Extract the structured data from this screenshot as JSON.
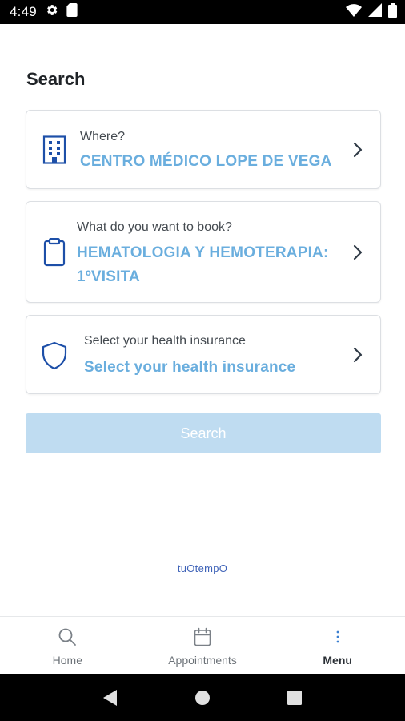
{
  "status_bar": {
    "time": "4:49",
    "icons": [
      "gear-icon",
      "sd-card-icon",
      "wifi-icon",
      "signal-icon",
      "battery-icon"
    ]
  },
  "page": {
    "title": "Search"
  },
  "cards": {
    "where": {
      "icon": "building-icon",
      "label": "Where?",
      "value": "CENTRO MÉDICO LOPE DE VEGA"
    },
    "booking": {
      "icon": "clipboard-icon",
      "label": "What do you want to book?",
      "value": "HEMATOLOGIA Y HEMOTERAPIA: 1ºVISITA"
    },
    "insurance": {
      "icon": "shield-icon",
      "label": "Select your health insurance",
      "value": "Select your health insurance"
    }
  },
  "search_button": {
    "label": "Search",
    "enabled": false
  },
  "footer": {
    "brand": "tuOtempO"
  },
  "bottom_nav": {
    "items": [
      {
        "label": "Home",
        "icon": "search-icon"
      },
      {
        "label": "Appointments",
        "icon": "calendar-icon"
      },
      {
        "label": "Menu",
        "icon": "more-vertical-icon",
        "active": true
      }
    ]
  },
  "colors": {
    "accent": "#6aaede",
    "icon_blue": "#1d4fa8",
    "button_disabled": "#bfdcf1",
    "brand": "#3f63b8"
  }
}
